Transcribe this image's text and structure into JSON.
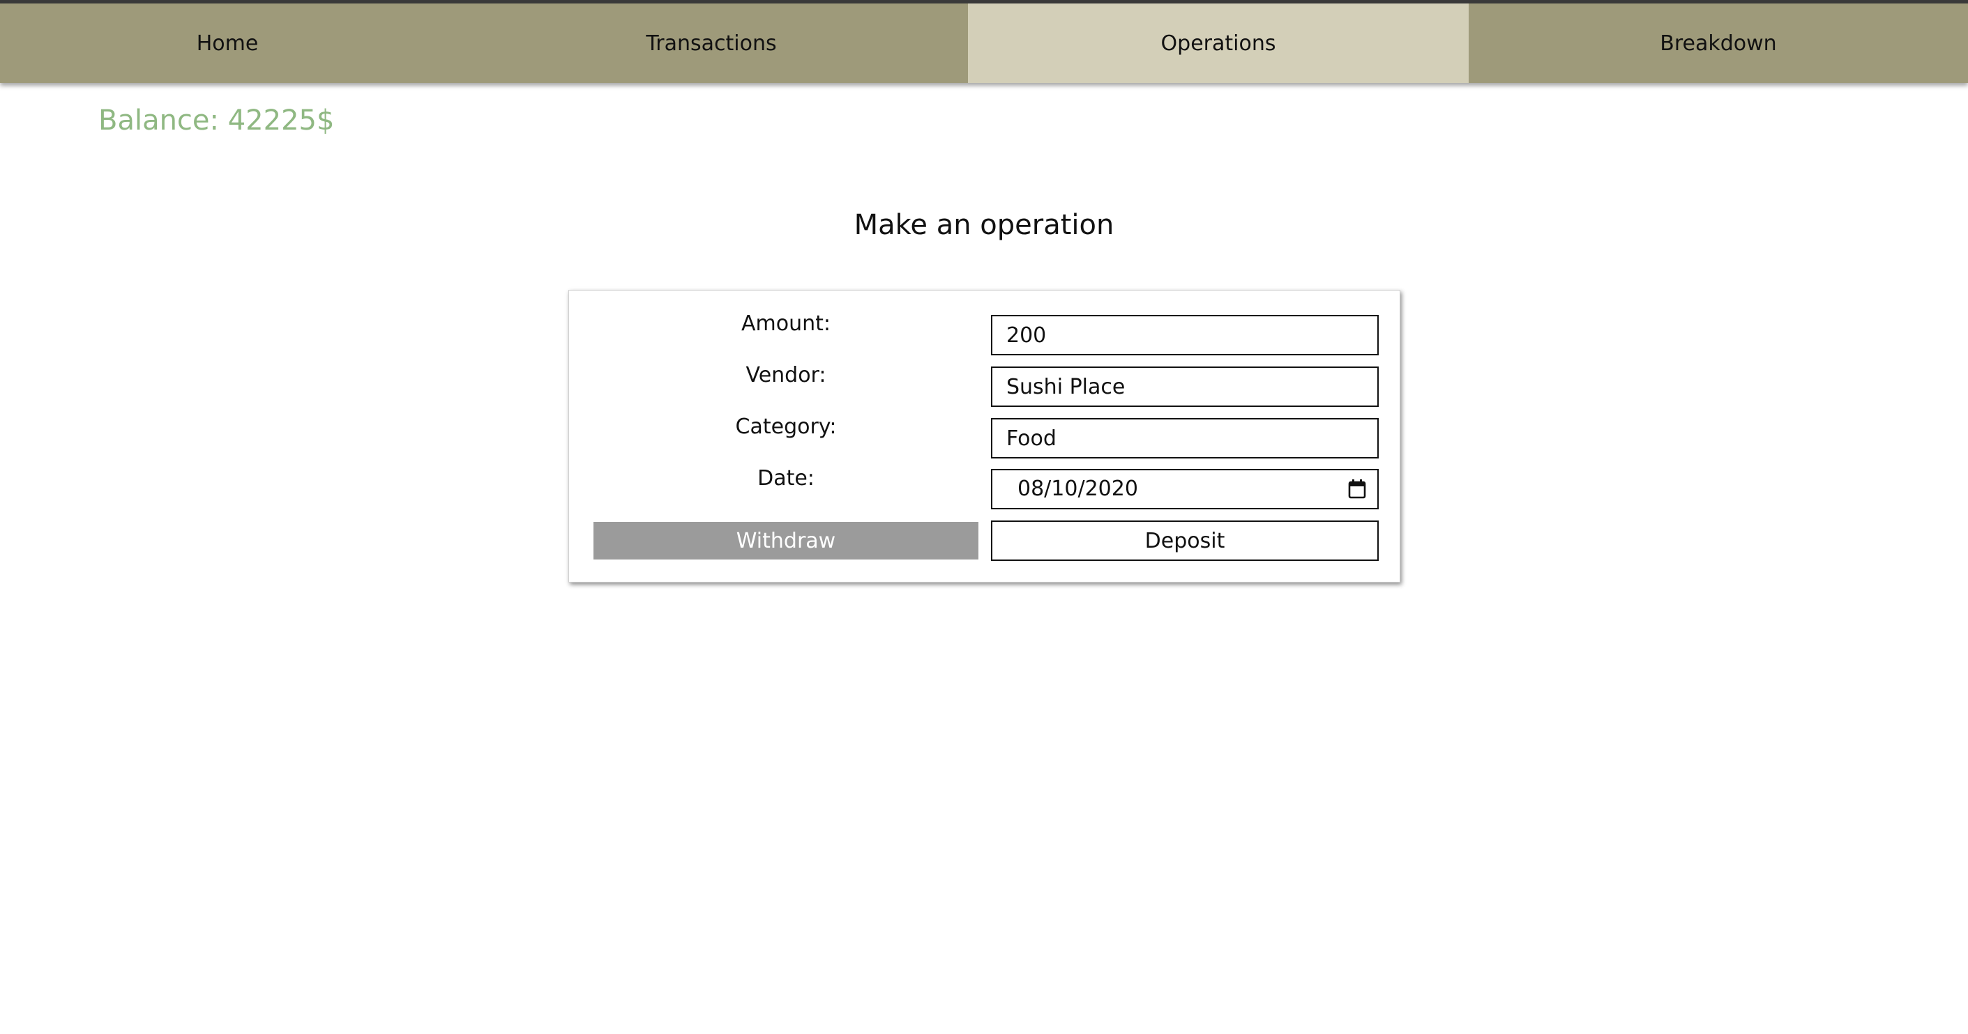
{
  "nav": {
    "items": [
      {
        "label": "Home"
      },
      {
        "label": "Transactions"
      },
      {
        "label": "Operations"
      },
      {
        "label": "Breakdown"
      }
    ],
    "active": "Operations"
  },
  "balance": {
    "label": "Balance: ",
    "value": "42225$"
  },
  "heading": "Make an operation",
  "form": {
    "amount": {
      "label": "Amount:",
      "value": "200"
    },
    "vendor": {
      "label": "Vendor:",
      "value": "Sushi Place"
    },
    "category": {
      "label": "Category:",
      "value": "Food"
    },
    "date": {
      "label": "Date:",
      "value": "08/10/2020",
      "icon": "calendar-icon"
    },
    "withdraw_label": "Withdraw",
    "deposit_label": "Deposit"
  },
  "colors": {
    "nav_bg": "#9e9a7a",
    "nav_active_bg": "#d3cfb8",
    "balance_text": "#8fb882",
    "withdraw_bg": "#9b9b9b"
  }
}
